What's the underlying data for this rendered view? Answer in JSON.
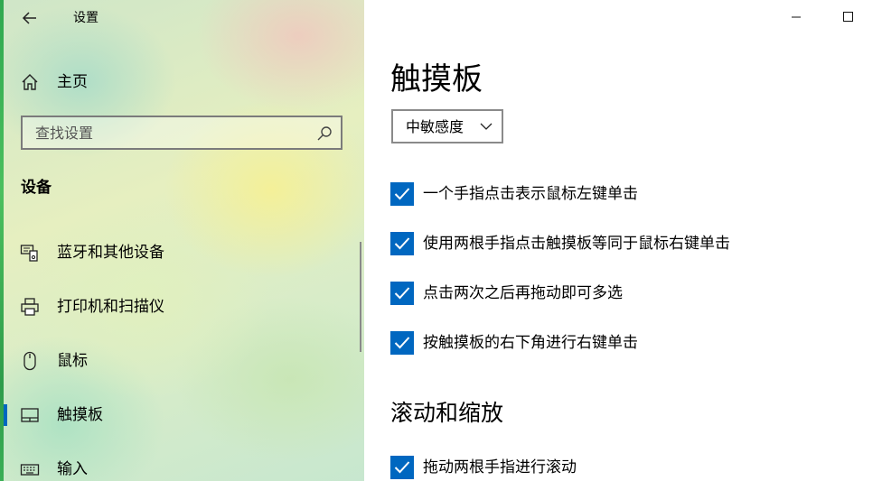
{
  "window": {
    "title": "设置",
    "controls": {
      "minimize_icon": "minimize-icon",
      "maximize_icon": "maximize-icon"
    }
  },
  "sidebar": {
    "home_label": "主页",
    "search": {
      "placeholder": "查找设置",
      "value": ""
    },
    "section_title": "设备",
    "items": [
      {
        "label": "蓝牙和其他设备",
        "icon": "bluetooth-devices-icon"
      },
      {
        "label": "打印机和扫描仪",
        "icon": "printer-icon"
      },
      {
        "label": "鼠标",
        "icon": "mouse-icon"
      },
      {
        "label": "触摸板",
        "icon": "touchpad-icon",
        "selected": true
      },
      {
        "label": "输入",
        "icon": "keyboard-icon"
      }
    ]
  },
  "main": {
    "title": "触摸板",
    "sensitivity": {
      "selected": "中敏感度"
    },
    "tap_options": [
      {
        "label": "一个手指点击表示鼠标左键单击",
        "checked": true
      },
      {
        "label": "使用两根手指点击触摸板等同于鼠标右键单击",
        "checked": true
      },
      {
        "label": "点击两次之后再拖动即可多选",
        "checked": true
      },
      {
        "label": "按触摸板的右下角进行右键单击",
        "checked": true
      }
    ],
    "scroll_zoom": {
      "title": "滚动和缩放",
      "options": [
        {
          "label": "拖动两根手指进行滚动",
          "checked": true
        }
      ]
    }
  },
  "colors": {
    "accent": "#0067c0",
    "selected_indicator": "#0067c0"
  }
}
